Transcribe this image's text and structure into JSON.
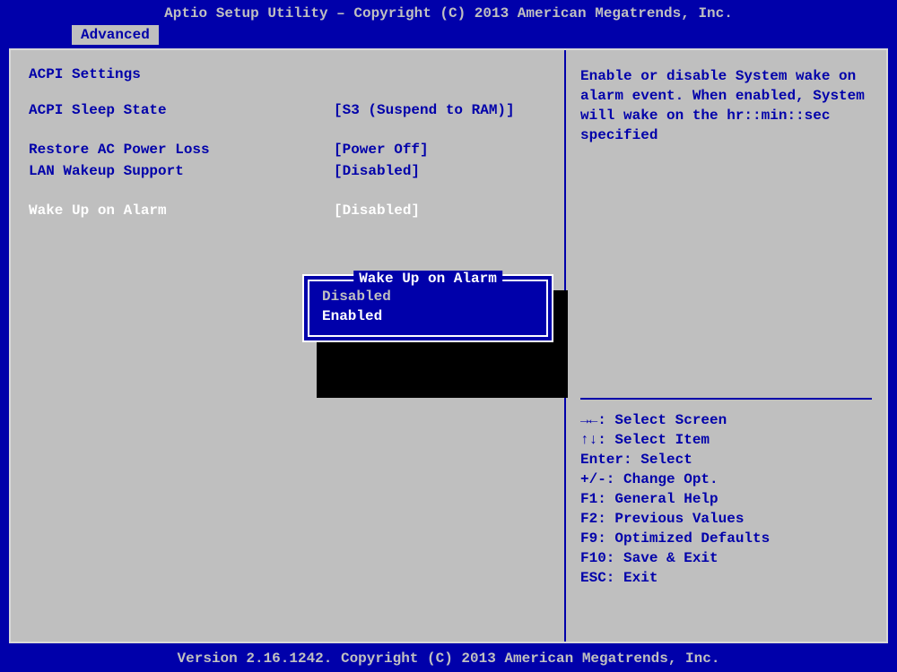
{
  "header": {
    "title": "Aptio Setup Utility – Copyright (C) 2013 American Megatrends, Inc."
  },
  "tabs": {
    "active": "Advanced"
  },
  "left": {
    "section": "ACPI Settings",
    "rows": [
      {
        "label": "ACPI Sleep State",
        "value": "[S3 (Suspend to RAM)]"
      },
      {
        "label": "",
        "value": ""
      },
      {
        "label": "Restore AC Power Loss",
        "value": "[Power Off]"
      },
      {
        "label": "LAN Wakeup Support",
        "value": "[Disabled]"
      },
      {
        "label": "",
        "value": ""
      },
      {
        "label": "Wake Up on Alarm",
        "value": "[Disabled]",
        "selected": true
      }
    ]
  },
  "popup": {
    "title": "Wake Up on Alarm",
    "options": [
      {
        "label": "Disabled",
        "selected": false
      },
      {
        "label": "Enabled",
        "selected": true
      }
    ]
  },
  "help": {
    "text": "Enable or disable System wake on alarm event. When enabled, System will wake on the hr::min::sec specified"
  },
  "keys": {
    "lines": [
      "→←: Select Screen",
      "↑↓: Select Item",
      "Enter: Select",
      "+/-: Change Opt.",
      "F1: General Help",
      "F2: Previous Values",
      "F9: Optimized Defaults",
      "F10: Save & Exit",
      "ESC: Exit"
    ]
  },
  "footer": {
    "text": "Version 2.16.1242. Copyright (C) 2013 American Megatrends, Inc."
  }
}
